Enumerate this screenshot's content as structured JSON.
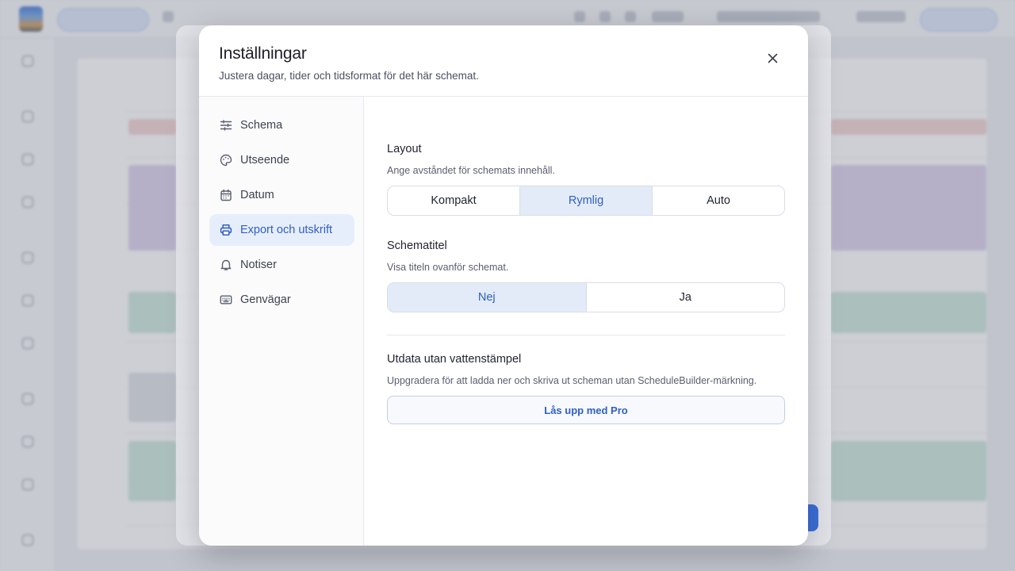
{
  "modal": {
    "title": "Inställningar",
    "subtitle": "Justera dagar, tider och tidsformat för det här schemat.",
    "close_icon": "close-icon"
  },
  "nav": {
    "items": [
      {
        "label": "Schema",
        "icon": "sliders-icon",
        "active": false
      },
      {
        "label": "Utseende",
        "icon": "palette-icon",
        "active": false
      },
      {
        "label": "Datum",
        "icon": "calendar-icon",
        "active": false
      },
      {
        "label": "Export och utskrift",
        "icon": "printer-icon",
        "active": true
      },
      {
        "label": "Notiser",
        "icon": "bell-icon",
        "active": false
      },
      {
        "label": "Genvägar",
        "icon": "keyboard-icon",
        "active": false
      }
    ]
  },
  "content": {
    "layout": {
      "title": "Layout",
      "description": "Ange avståndet för schemats innehåll.",
      "options": [
        "Kompakt",
        "Rymlig",
        "Auto"
      ],
      "selected": "Rymlig"
    },
    "schedule_title": {
      "title": "Schematitel",
      "description": "Visa titeln ovanför schemat.",
      "options": [
        "Nej",
        "Ja"
      ],
      "selected": "Nej"
    },
    "watermark": {
      "title": "Utdata utan vattenstämpel",
      "description": "Uppgradera för att ladda ner och skriva ut scheman utan ScheduleBuilder-märkning.",
      "button_label": "Lås upp med Pro"
    }
  },
  "colors": {
    "accent": "#2f5fc4",
    "selected_bg": "#e3ebf8",
    "nav_active_bg": "#e7eefb"
  }
}
